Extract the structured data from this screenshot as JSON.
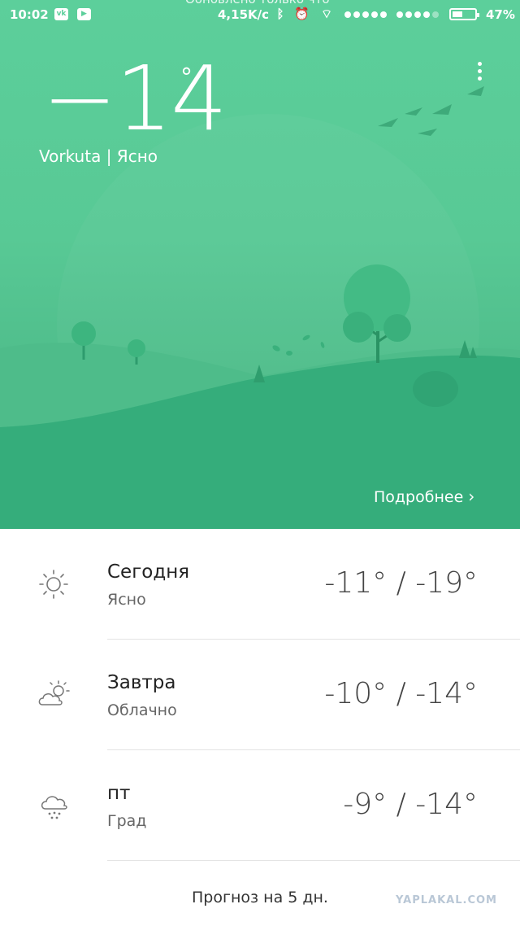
{
  "status_bar": {
    "time": "10:02",
    "network_speed": "4,15K/c",
    "battery_percent": "47%",
    "battery_level": 0.47,
    "notification_ghost": "Обновлено только что",
    "app_icons": [
      "vk-icon",
      "play-store-icon"
    ],
    "system_icons": [
      "bluetooth-icon",
      "alarm-icon",
      "wifi-icon"
    ]
  },
  "current": {
    "temperature": "−14",
    "degree_symbol": "°",
    "city": "Vorkuta",
    "separator": "|",
    "condition": "Ясно"
  },
  "hero": {
    "details_label": "Подробнее",
    "accent_color": "#5ccf9b"
  },
  "forecast": [
    {
      "day": "Сегодня",
      "condition": "Ясно",
      "range": "-11° / -19°",
      "icon": "sun-icon"
    },
    {
      "day": "Завтра",
      "condition": "Облачно",
      "range": "-10° / -14°",
      "icon": "partly-cloudy-icon"
    },
    {
      "day": "пт",
      "condition": "Град",
      "range": "-9° / -14°",
      "icon": "hail-icon"
    }
  ],
  "five_day_label": "Прогноз на 5 дн.",
  "watermark": "YAPLAKAL.COM"
}
